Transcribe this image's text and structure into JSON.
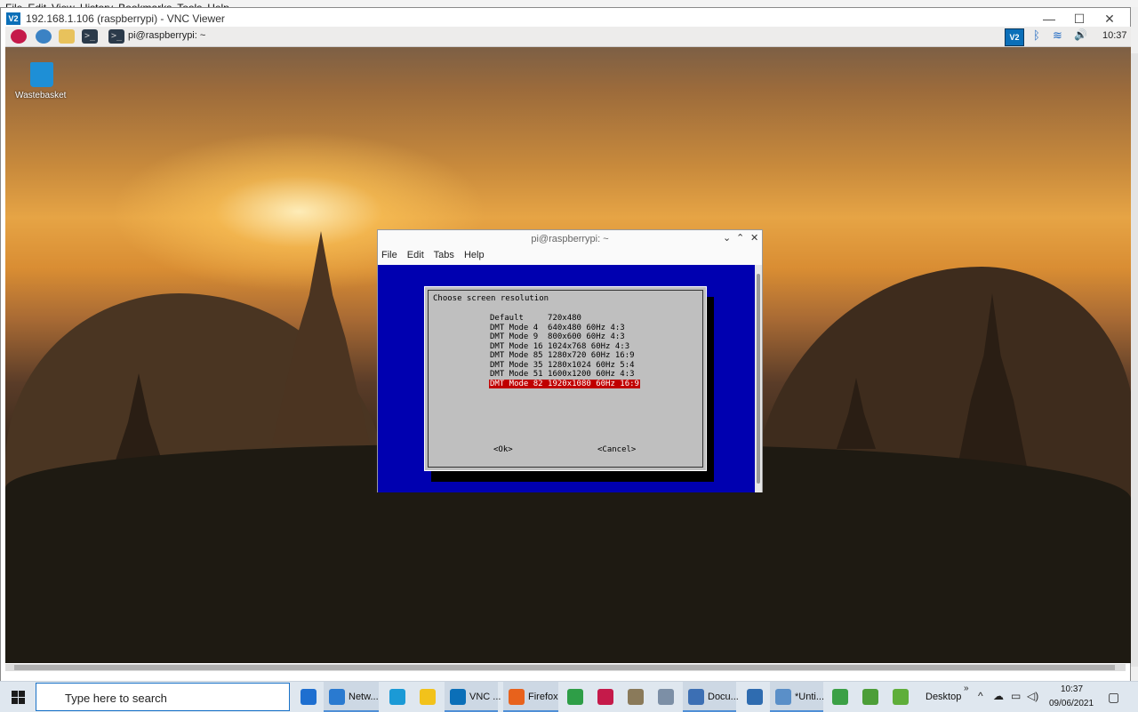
{
  "host_menu": [
    "File",
    "Edit",
    "View",
    "History",
    "Bookmarks",
    "Tools",
    "Help"
  ],
  "vnc": {
    "logo": "V2",
    "title": "192.168.1.106 (raspberrypi) - VNC Viewer",
    "minimize": "—",
    "maximize": "☐",
    "close": "✕"
  },
  "pi_panel": {
    "terminal_glyph": ">_",
    "task_label": "pi@raspberrypi: ~",
    "tray_vnc": "V2",
    "bluetooth": "ᛒ",
    "wifi": "≋",
    "volume": "🔊",
    "clock": "10:37"
  },
  "desktop": {
    "wastebasket_label": "Wastebasket"
  },
  "terminal": {
    "title": "pi@raspberrypi: ~",
    "ctrl_down": "⌄",
    "ctrl_up": "⌃",
    "ctrl_close": "✕",
    "menu": [
      "File",
      "Edit",
      "Tabs",
      "Help"
    ]
  },
  "dialog": {
    "title": "Choose screen resolution",
    "items": [
      "Default     720x480",
      "DMT Mode 4  640x480 60Hz 4:3",
      "DMT Mode 9  800x600 60Hz 4:3",
      "DMT Mode 16 1024x768 60Hz 4:3",
      "DMT Mode 85 1280x720 60Hz 16:9",
      "DMT Mode 35 1280x1024 60Hz 5:4",
      "DMT Mode 51 1600x1200 60Hz 4:3",
      "DMT Mode 82 1920x1080 60Hz 16:9"
    ],
    "selected_index": 7,
    "ok": "<Ok>",
    "cancel": "<Cancel>"
  },
  "taskbar": {
    "search_placeholder": "Type here to search",
    "apps": [
      {
        "name": "mail",
        "label": "",
        "color": "#1e6fd0"
      },
      {
        "name": "network",
        "label": "Netw...",
        "color": "#2a7ad0"
      },
      {
        "name": "edge",
        "label": "",
        "color": "#1b9ad6"
      },
      {
        "name": "sticky-notes",
        "label": "",
        "color": "#f2c21b"
      },
      {
        "name": "vnc",
        "label": "VNC ...",
        "color": "#0b6fb8"
      },
      {
        "name": "firefox",
        "label": "Firefox",
        "color": "#e8621c"
      },
      {
        "name": "chrome",
        "label": "",
        "color": "#2e9e47"
      },
      {
        "name": "raspberry",
        "label": "",
        "color": "#c51a4a"
      },
      {
        "name": "scanner",
        "label": "",
        "color": "#8a7a5a"
      },
      {
        "name": "paint",
        "label": "",
        "color": "#7c8fa6"
      },
      {
        "name": "documents",
        "label": "Docu...",
        "color": "#3c6fb4"
      },
      {
        "name": "network-share",
        "label": "",
        "color": "#2f6cb0"
      },
      {
        "name": "notepad",
        "label": "*Unti...",
        "color": "#5a8fc8"
      },
      {
        "name": "tool-green",
        "label": "",
        "color": "#3ba046"
      },
      {
        "name": "editor-green",
        "label": "",
        "color": "#4c9e38"
      },
      {
        "name": "app-green",
        "label": "",
        "color": "#5fae3a"
      }
    ],
    "desktop_label": "Desktop",
    "chevron": "»",
    "time": "10:37",
    "date": "09/06/2021"
  }
}
